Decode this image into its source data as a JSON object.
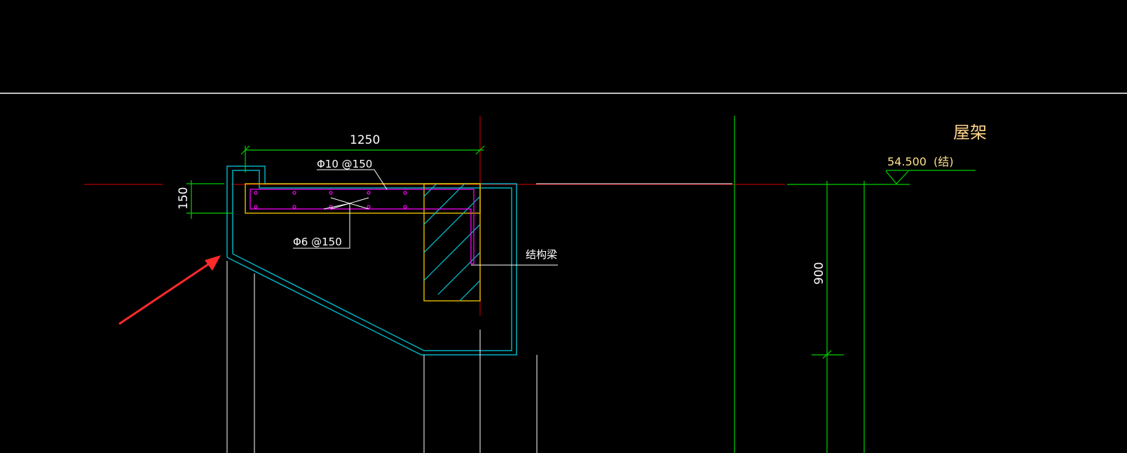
{
  "drawing": {
    "colors": {
      "background": "#000000",
      "axis_red": "#b00000",
      "dimension_green": "#00d000",
      "outline_cyan": "#00b0c0",
      "beam_yellow": "#d8b000",
      "rebar_magenta": "#ff00ff",
      "leader_white": "#ffffff",
      "arrow_red": "#ff2a2a",
      "text_yellow": "#ffe08a"
    },
    "labels": {
      "dim_width": "1250",
      "dim_height_left": "150",
      "dim_height_right": "900",
      "rebar_main": "Φ10 @150",
      "rebar_dist": "Φ6 @150",
      "beam_label": "结构梁",
      "elevation_value": "54.500",
      "elevation_note": "(结)",
      "section_title": "屋架"
    },
    "icons": {
      "pointer": "red-arrow-icon",
      "elevation": "elevation-triangle-icon"
    }
  }
}
